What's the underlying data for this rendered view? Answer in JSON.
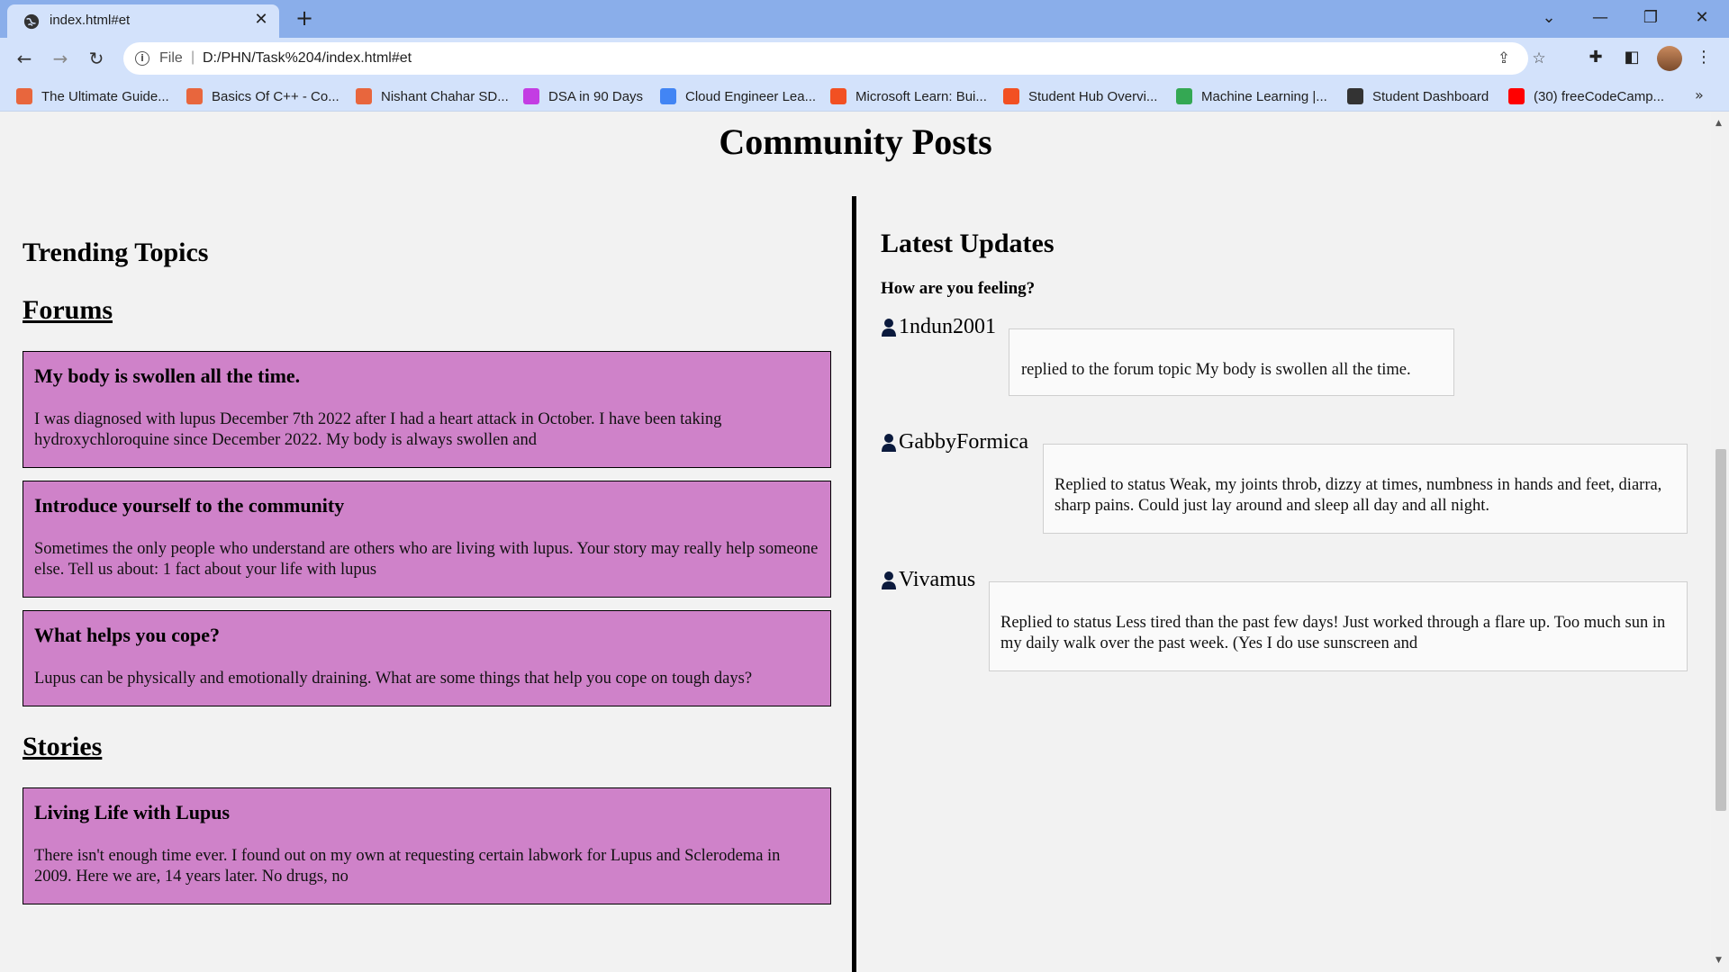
{
  "browser": {
    "tab_title": "index.html#et",
    "url_scheme": "File",
    "url": "D:/PHN/Task%204/index.html#et",
    "bookmarks": [
      {
        "label": "The Ultimate Guide...",
        "color": "#e8663d"
      },
      {
        "label": "Basics Of C++ - Co...",
        "color": "#e8663d"
      },
      {
        "label": "Nishant Chahar SD...",
        "color": "#e8663d"
      },
      {
        "label": "DSA in 90 Days",
        "color": "#c33de3"
      },
      {
        "label": "Cloud Engineer Lea...",
        "color": "#4285f4"
      },
      {
        "label": "Microsoft Learn: Bui...",
        "color": "#f25022"
      },
      {
        "label": "Student Hub Overvi...",
        "color": "#f25022"
      },
      {
        "label": "Machine Learning  |...",
        "color": "#34a853"
      },
      {
        "label": "Student Dashboard",
        "color": "#333333"
      },
      {
        "label": "(30) freeCodeCamp...",
        "color": "#ff0000"
      }
    ],
    "more_label": "»"
  },
  "page": {
    "title": "Community Posts",
    "trending": {
      "title": "Trending Topics",
      "forums_label": "Forums",
      "forums": [
        {
          "title": "My body is swollen all the time.",
          "body": "I was diagnosed with lupus December 7th 2022 after I had a heart attack in October. I have been taking hydroxychloroquine since December 2022. My body is always swollen and"
        },
        {
          "title": "Introduce yourself to the community",
          "body": "Sometimes the only people who understand are others who are living with lupus. Your story may really help someone else. Tell us about: 1 fact about your life with lupus"
        },
        {
          "title": "What helps you cope?",
          "body": "Lupus can be physically and emotionally draining. What are some things that help you cope on tough days?"
        }
      ],
      "stories_label": "Stories",
      "stories": [
        {
          "title": "Living Life with Lupus",
          "body": "There isn't enough time ever. I found out on my own at requesting certain labwork for Lupus and Sclerodema in 2009. Here we are, 14 years later. No drugs, no"
        }
      ]
    },
    "latest": {
      "title": "Latest Updates",
      "prompt": "How are you feeling?",
      "updates": [
        {
          "user": "1ndun2001",
          "text": "replied to the forum topic My body is swollen all the time."
        },
        {
          "user": "GabbyFormica",
          "text": "Replied to status Weak, my joints throb, dizzy at times, numbness in hands and feet, diarra, sharp pains. Could just lay around and sleep all day and all night."
        },
        {
          "user": "Vivamus",
          "text": "Replied to status Less tired than the past few days! Just worked through a flare up. Too much sun in my daily walk over the past week. (Yes I do use sunscreen and"
        }
      ]
    }
  },
  "colors": {
    "card_bg": "#cf82c9",
    "page_bg": "#f2f2f2",
    "chrome_tabbar": "#8aaeea",
    "chrome_toolbar": "#d3e2fb"
  }
}
